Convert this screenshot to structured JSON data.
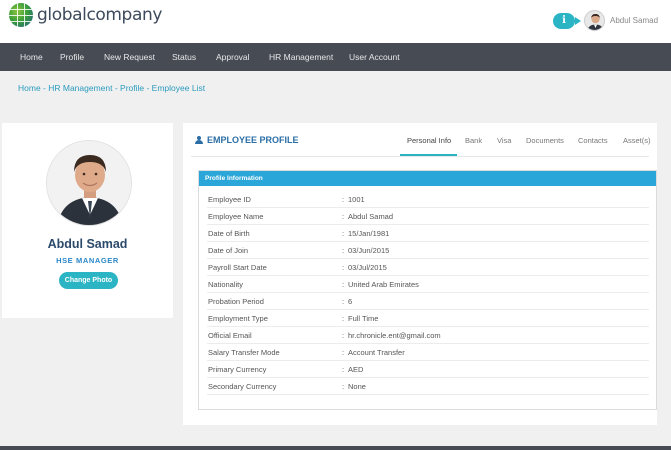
{
  "header": {
    "logo_text": "globalcompany",
    "info_label": "i",
    "username": "Abdul Samad"
  },
  "nav": {
    "items": [
      "Home",
      "Profile",
      "New Request",
      "Status",
      "Approval",
      "HR Management",
      "User Account"
    ]
  },
  "breadcrumb": "Home - HR Management - Profile - Employee List",
  "profile_card": {
    "name": "Abdul Samad",
    "role": "HSE MANAGER",
    "change_photo_label": "Change Photo"
  },
  "employee_profile": {
    "title": "EMPLOYEE PROFILE",
    "tabs": [
      "Personal Info",
      "Bank",
      "Visa",
      "Documents",
      "Contacts",
      "Asset(s)"
    ],
    "active_tab": "Personal Info",
    "section_title": "Profile Information",
    "separator": ":",
    "fields": [
      {
        "label": "Employee ID",
        "value": "1001"
      },
      {
        "label": "Employee Name",
        "value": "Abdul Samad"
      },
      {
        "label": "Date of Birth",
        "value": "15/Jan/1981"
      },
      {
        "label": "Date of Join",
        "value": "03/Jun/2015"
      },
      {
        "label": "Payroll Start Date",
        "value": "03/Jul/2015"
      },
      {
        "label": "Nationality",
        "value": "United Arab Emirates"
      },
      {
        "label": "Probation Period",
        "value": "6"
      },
      {
        "label": "Employment Type",
        "value": "Full Time"
      },
      {
        "label": "Official Email",
        "value": "hr.chronicle.ent@gmail.com"
      },
      {
        "label": "Salary Transfer Mode",
        "value": "Account Transfer"
      },
      {
        "label": "Primary Currency",
        "value": "AED"
      },
      {
        "label": "Secondary Currency",
        "value": "None"
      }
    ]
  },
  "colors": {
    "accent": "#2bb5c4",
    "nav_bg": "#464b54",
    "panel_head": "#2aa6d9",
    "title_blue": "#2b6ea5"
  }
}
